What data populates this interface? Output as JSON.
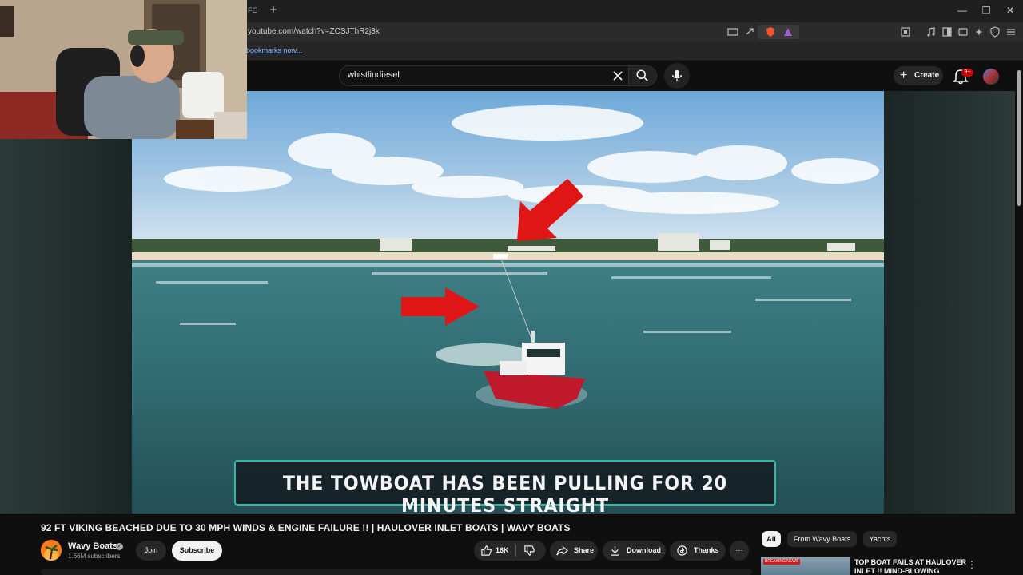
{
  "browser": {
    "tab_fragment": "FE",
    "url": "youtube.com/watch?v=ZCSJThR2j3k",
    "bookmarks_text": "bookmarks now..."
  },
  "header": {
    "search_query": "whistlindiesel",
    "create_label": "Create",
    "notification_badge": "9+"
  },
  "video": {
    "caption": "THE TOWBOAT HAS BEEN PULLING FOR 20 MINUTES STRAIGHT",
    "title": "92 FT VIKING BEACHED DUE TO 30 MPH WINDS & ENGINE FAILURE !! | HAULOVER INLET BOATS | WAVY BOATS"
  },
  "channel": {
    "name": "Wavy Boats",
    "subscribers": "1.66M subscribers",
    "join_label": "Join",
    "subscribe_label": "Subscribe"
  },
  "actions": {
    "likes": "16K",
    "share_label": "Share",
    "download_label": "Download",
    "thanks_label": "Thanks",
    "more_label": "⋯"
  },
  "chips": {
    "all": "All",
    "from_channel": "From Wavy Boats",
    "yachts": "Yachts"
  },
  "recommendation": {
    "badge": "BREAKING NEWS",
    "title": "TOP BOAT FAILS AT HAULOVER INLET !! MIND-BLOWING"
  },
  "colors": {
    "accent_red": "#cc0000",
    "caption_border": "#2fb7a7",
    "background": "#0f0f0f"
  }
}
